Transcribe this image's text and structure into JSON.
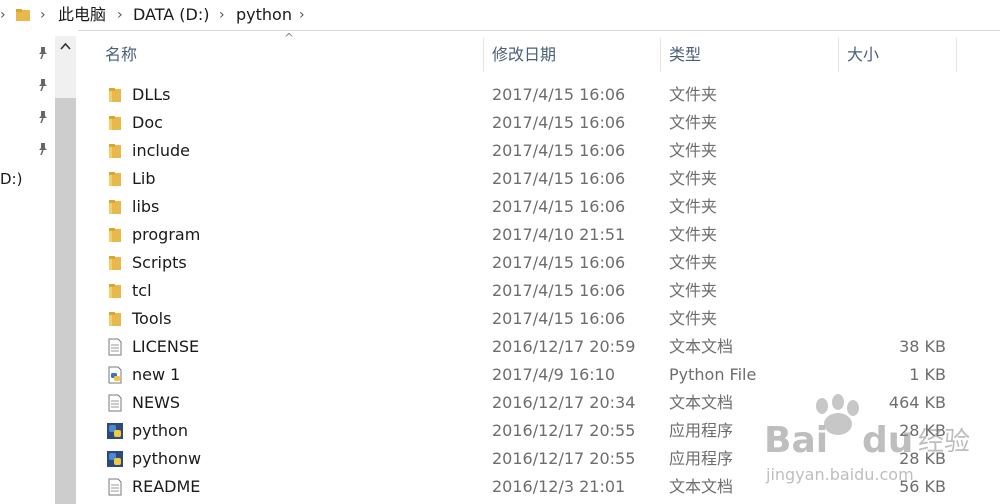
{
  "breadcrumb": {
    "items": [
      "此电脑",
      "DATA (D:)",
      "python"
    ]
  },
  "nav": {
    "drive_fragment": "D:)"
  },
  "columns": {
    "name": "名称",
    "modified": "修改日期",
    "type": "类型",
    "size": "大小"
  },
  "files": [
    {
      "name": "DLLs",
      "modified": "2017/4/15 16:06",
      "type": "文件夹",
      "size": "",
      "icon": "folder-icon"
    },
    {
      "name": "Doc",
      "modified": "2017/4/15 16:06",
      "type": "文件夹",
      "size": "",
      "icon": "folder-icon"
    },
    {
      "name": "include",
      "modified": "2017/4/15 16:06",
      "type": "文件夹",
      "size": "",
      "icon": "folder-icon"
    },
    {
      "name": "Lib",
      "modified": "2017/4/15 16:06",
      "type": "文件夹",
      "size": "",
      "icon": "folder-icon"
    },
    {
      "name": "libs",
      "modified": "2017/4/15 16:06",
      "type": "文件夹",
      "size": "",
      "icon": "folder-icon"
    },
    {
      "name": "program",
      "modified": "2017/4/10 21:51",
      "type": "文件夹",
      "size": "",
      "icon": "folder-icon"
    },
    {
      "name": "Scripts",
      "modified": "2017/4/15 16:06",
      "type": "文件夹",
      "size": "",
      "icon": "folder-icon"
    },
    {
      "name": "tcl",
      "modified": "2017/4/15 16:06",
      "type": "文件夹",
      "size": "",
      "icon": "folder-icon"
    },
    {
      "name": "Tools",
      "modified": "2017/4/15 16:06",
      "type": "文件夹",
      "size": "",
      "icon": "folder-icon"
    },
    {
      "name": "LICENSE",
      "modified": "2016/12/17 20:59",
      "type": "文本文档",
      "size": "38 KB",
      "icon": "text-document-icon"
    },
    {
      "name": "new 1",
      "modified": "2017/4/9 16:10",
      "type": "Python File",
      "size": "1 KB",
      "icon": "python-file-icon"
    },
    {
      "name": "NEWS",
      "modified": "2016/12/17 20:34",
      "type": "文本文档",
      "size": "464 KB",
      "icon": "text-document-icon"
    },
    {
      "name": "python",
      "modified": "2016/12/17 20:55",
      "type": "应用程序",
      "size": "28 KB",
      "icon": "python-app-icon"
    },
    {
      "name": "pythonw",
      "modified": "2016/12/17 20:55",
      "type": "应用程序",
      "size": "28 KB",
      "icon": "python-app-icon"
    },
    {
      "name": "README",
      "modified": "2016/12/3 21:01",
      "type": "文本文档",
      "size": "56 KB",
      "icon": "text-document-icon"
    }
  ],
  "watermark": {
    "brand": "Bai du 经验",
    "url": "jingyan.baidu.com"
  },
  "colors": {
    "header_text": "#4c607a",
    "folder_yellow": "#e8b84a",
    "secondary_text": "#6d6d6d"
  }
}
